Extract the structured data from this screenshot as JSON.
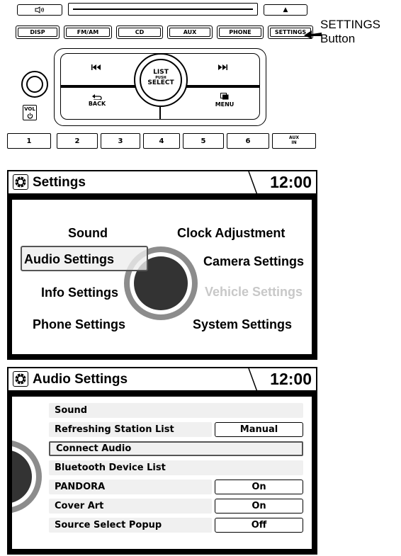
{
  "head_unit": {
    "eject_symbol": "▲",
    "source_buttons": [
      "DISP",
      "FM/AM",
      "CD",
      "AUX",
      "PHONE",
      "SETTINGS"
    ],
    "prev_label": "",
    "next_label": "",
    "list_select": {
      "line1": "LIST",
      "line2": "PUSH",
      "line3": "SELECT"
    },
    "back_label": "BACK",
    "menu_label": "MENU",
    "vol_label": "VOL",
    "presets": [
      "1",
      "2",
      "3",
      "4",
      "5",
      "6"
    ],
    "aux_in": {
      "line1": "AUX",
      "line2": "IN"
    }
  },
  "callout": {
    "line1": "SETTINGS",
    "line2": "Button"
  },
  "settings_screen": {
    "title": "Settings",
    "clock": "12:00",
    "left_items": [
      "Sound",
      "Audio Settings",
      "Info Settings",
      "Phone Settings"
    ],
    "right_items": [
      "Clock Adjustment",
      "Camera Settings",
      "Vehicle Settings",
      "System Settings"
    ],
    "selected": "Audio Settings",
    "disabled": "Vehicle Settings"
  },
  "audio_screen": {
    "title": "Audio Settings",
    "clock": "12:00",
    "rows": [
      {
        "label": "Sound",
        "value": ""
      },
      {
        "label": "Refreshing Station List",
        "value": "Manual"
      },
      {
        "label": "Connect Audio",
        "value": ""
      },
      {
        "label": "Bluetooth Device List",
        "value": ""
      },
      {
        "label": "PANDORA",
        "value": "On"
      },
      {
        "label": "Cover Art",
        "value": "On"
      },
      {
        "label": "Source Select Popup",
        "value": "Off"
      }
    ],
    "selected_row": "Connect Audio"
  },
  "colors": {
    "disabled_text": "#c8c8c8",
    "knob_dark": "#333333",
    "knob_ring": "#8c8c8c"
  }
}
